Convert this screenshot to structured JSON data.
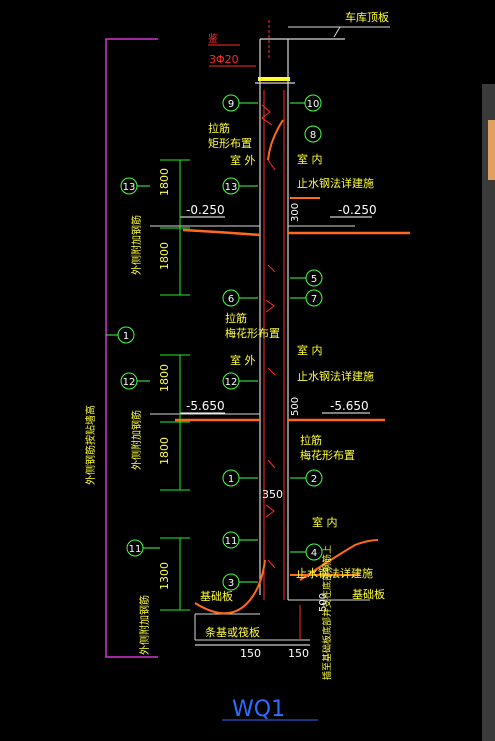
{
  "drawing": {
    "title": "WQ1",
    "colors": {
      "background": "#000000",
      "wall": "#d8d8d8",
      "bar_red": "#ff2a2a",
      "floor_orange": "#ff6a1a",
      "dim_green": "#22ee22",
      "text_yellow": "#ffff33",
      "text_white": "#ffffff",
      "callout_green": "#44ff44",
      "magenta": "#d633d6",
      "title_blue": "#2f6bff"
    }
  },
  "top": {
    "roof_label": "车库顶板",
    "rebar_callout": "3Φ20",
    "red_tag": "鉴"
  },
  "levels": {
    "upper": "-0.250",
    "lower": "-5.650"
  },
  "labels": {
    "outside": "室 外",
    "inside": "室 内",
    "waterstop": "止水钢法详建施",
    "tie_rect": [
      "拉筋",
      "矩形布置"
    ],
    "tie_quincunx": [
      "拉筋",
      "梅花形布置"
    ],
    "outer_reinf": "外侧附加钢筋",
    "outer_reinf_long": "外侧钢筋按贴墙高",
    "strip_foundation": "条基或筏板",
    "base_slab": "基础板",
    "base_slab_right": "基础板",
    "anchor_note": "插至基础板底部并支在底部钢筋上"
  },
  "dimensions": {
    "d1800a": "1800",
    "d1800b": "1800",
    "d1800c": "1800",
    "d1800d": "1800",
    "d1300": "1300",
    "d300": "300",
    "d500a": "500",
    "d500b": "500",
    "d350": "350",
    "d150a": "150",
    "d150b": "150"
  },
  "callouts": {
    "c1": "1",
    "c2": "2",
    "c3": "3",
    "c4": "4",
    "c5": "5",
    "c6": "6",
    "c7": "7",
    "c8": "8",
    "c9": "9",
    "c10": "10",
    "c11": "11",
    "c12": "12",
    "c13": "13"
  }
}
